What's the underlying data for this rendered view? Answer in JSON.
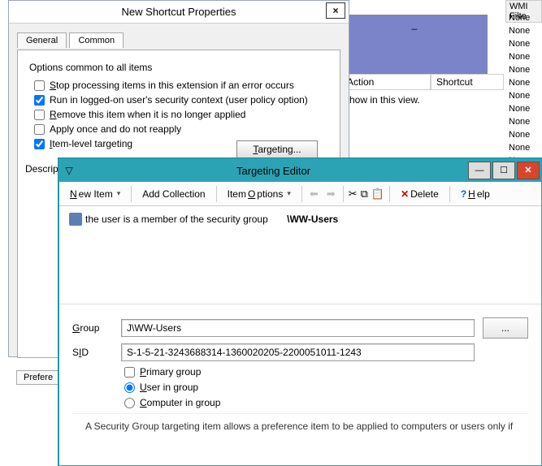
{
  "bg": {
    "wmi_header": "WMI Filte",
    "none_items": [
      "None",
      "None",
      "None",
      "None",
      "None",
      "None",
      "None",
      "None",
      "None",
      "None",
      "None",
      "None"
    ],
    "action_col": "Action",
    "shortcut_col": "Shortcut",
    "show_text": "show in this view."
  },
  "props": {
    "title": "New Shortcut Properties",
    "close": "×",
    "tabs": {
      "general": "General",
      "common": "Common"
    },
    "options_label": "Options common to all items",
    "chk_stop": "Stop processing items in this extension if an error occurs",
    "chk_run": "Run in logged-on user's security context (user policy option)",
    "chk_remove": "Remove this item when it is no longer applied",
    "chk_apply": "Apply once and do not reapply",
    "chk_target": "Item-level targeting",
    "targeting_btn": "Targeting...",
    "description": "Descripti",
    "prefs_tab": "Prefere"
  },
  "te": {
    "title": "Targeting Editor",
    "toolbar": {
      "new_item": "New Item",
      "add_collection": "Add Collection",
      "item_options": "Item Options",
      "delete": "Delete",
      "help": "Help"
    },
    "tree": {
      "prefix": "the user is a member of the security group",
      "group": "\\WW-Users"
    },
    "form": {
      "group_label": "Group",
      "group_value": "J\\WW-Users",
      "browse": "...",
      "sid_label": "SID",
      "sid_value": "S-1-5-21-3243688314-1360020205-2200051011-1243",
      "primary": "Primary group",
      "user_in": "User in group",
      "comp_in": "Computer in group"
    },
    "desc": "A Security Group targeting item allows a preference item to be applied to computers or users only if"
  }
}
